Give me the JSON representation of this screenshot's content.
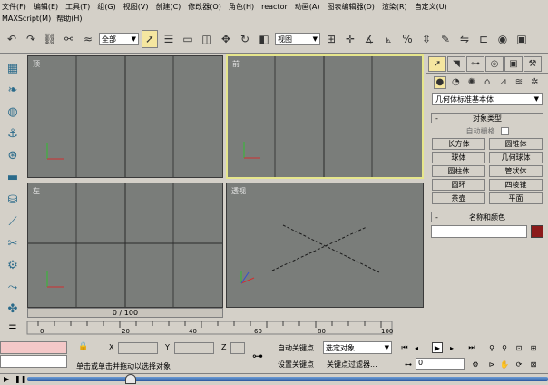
{
  "menu": [
    "文件(F)",
    "编辑(E)",
    "工具(T)",
    "组(G)",
    "视图(V)",
    "创建(C)",
    "修改器(O)",
    "角色(H)",
    "reactor",
    "动画(A)",
    "图表编辑器(D)",
    "渲染(R)",
    "自定义(U)"
  ],
  "menu2": [
    "MAXScript(M)",
    "帮助(H)"
  ],
  "toolbar": {
    "selection_filter": "全部",
    "ref_coord": "视图"
  },
  "viewports": {
    "top": "顶",
    "front": "前",
    "left": "左",
    "perspective": "透视"
  },
  "command_panel": {
    "category": "几何体",
    "category_suffix": "标准基本体",
    "rollout_object_type": "对象类型",
    "autogrid": "自动栅格",
    "objects": [
      "长方体",
      "圆锥体",
      "球体",
      "几何球体",
      "圆柱体",
      "管状体",
      "圆环",
      "四棱锥",
      "茶壶",
      "平面"
    ],
    "rollout_name_color": "名称和颜色",
    "object_color": "#8b1a1a"
  },
  "time": {
    "slider_label": "0 / 100",
    "ruler_ticks": [
      "0",
      "20",
      "40",
      "60",
      "80",
      "100"
    ]
  },
  "status": {
    "prompt": "单击或单击并拖动以选择对象",
    "autokey": "自动关键点",
    "selected_dropdown": "选定对象",
    "set_key": "设置关键点",
    "key_filters": "关键点过滤器...",
    "frame": "0"
  },
  "colors": {
    "viewport_bg": "#7a7d7a",
    "active_border": "#e6e68c",
    "accent": "#f5e6a0"
  }
}
